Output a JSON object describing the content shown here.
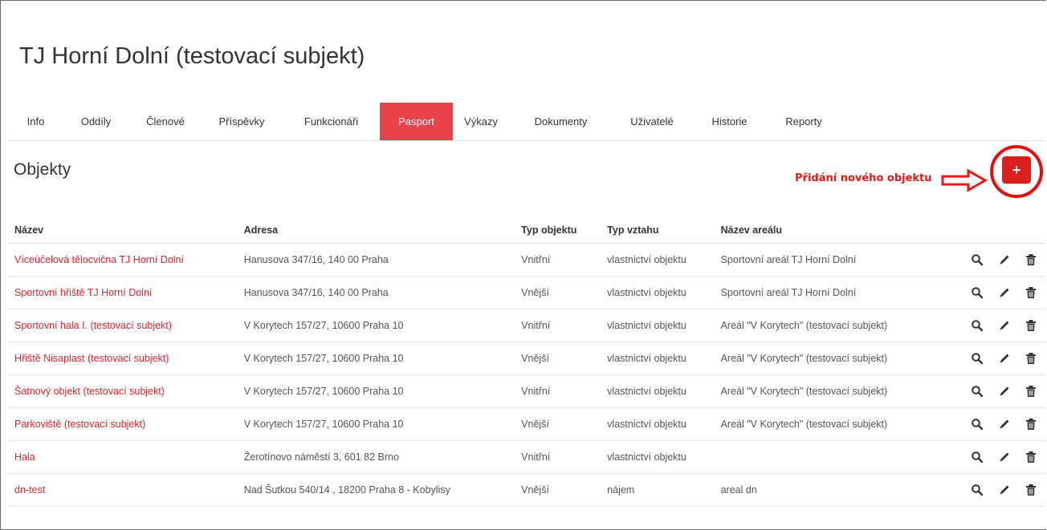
{
  "header": {
    "title": "TJ Horní Dolní (testovací subjekt)"
  },
  "tabs": [
    {
      "label": "Info",
      "active": false
    },
    {
      "label": "Oddíly",
      "active": false
    },
    {
      "label": "Členové",
      "active": false
    },
    {
      "label": "Příspěvky",
      "active": false
    },
    {
      "label": "Funkcionáři",
      "active": false
    },
    {
      "label": "Pasport",
      "active": true
    },
    {
      "label": "Výkazy",
      "active": false
    },
    {
      "label": "Dokumenty",
      "active": false
    },
    {
      "label": "Uživatelé",
      "active": false
    },
    {
      "label": "Historie",
      "active": false
    },
    {
      "label": "Reporty",
      "active": false
    }
  ],
  "section": {
    "title": "Objekty",
    "annotation": "Přidání nového objektu",
    "add_label": "+"
  },
  "table": {
    "columns": [
      "Název",
      "Adresa",
      "Typ objektu",
      "Typ vztahu",
      "Název areálu"
    ],
    "rows": [
      {
        "name": "Víceúčelová tělocvična TJ Horní Dolní",
        "address": "Hanusova 347/16, 140 00 Praha",
        "type": "Vnitřní",
        "relation": "vlastnictví objektu",
        "area": "Sportovní areál TJ Horní Dolní"
      },
      {
        "name": "Sportovní hřiště TJ Horní Dolní",
        "address": "Hanusova 347/16, 140 00 Praha",
        "type": "Vnější",
        "relation": "vlastnictví objektu",
        "area": "Sportovní areál TJ Horní Dolní"
      },
      {
        "name": "Sportovní hala I. (testovací subjekt)",
        "address": "V Korytech 157/27, 10600 Praha 10",
        "type": "Vnitřní",
        "relation": "vlastnictví objektu",
        "area": "Areál \"V Korytech\" (testovací subjekt)"
      },
      {
        "name": "Hřiště Nisaplast (testovací subjekt)",
        "address": "V Korytech 157/27, 10600 Praha 10",
        "type": "Vnější",
        "relation": "vlastnictví objektu",
        "area": "Areál \"V Korytech\" (testovací subjekt)"
      },
      {
        "name": "Šatnový objekt (testovací subjekt)",
        "address": "V Korytech 157/27, 10600 Praha 10",
        "type": "Vnitřní",
        "relation": "vlastnictví objektu",
        "area": "Areál \"V Korytech\" (testovací subjekt)"
      },
      {
        "name": "Parkoviště (testovací subjekt)",
        "address": "V Korytech 157/27, 10600 Praha 10",
        "type": "Vnější",
        "relation": "vlastnictví objektu",
        "area": "Areál \"V Korytech\" (testovací subjekt)"
      },
      {
        "name": "Hala",
        "address": "Žerotínovo náměstí 3, 601 82 Brno",
        "type": "Vnitřní",
        "relation": "vlastnictví objektu",
        "area": ""
      },
      {
        "name": "dn-test",
        "address": "Nad Šutkou 540/14 , 18200 Praha 8 - Kobylisy",
        "type": "Vnější",
        "relation": "nájem",
        "area": "areal dn"
      }
    ]
  },
  "icons": {
    "view": "search-icon",
    "edit": "pencil-icon",
    "delete": "trash-icon",
    "annotation_arrow": "arrow-right-icon"
  },
  "colors": {
    "accent": "#e8434c",
    "link": "#d9262c",
    "add_button": "#d9201d",
    "annotation": "#e21a1a"
  }
}
